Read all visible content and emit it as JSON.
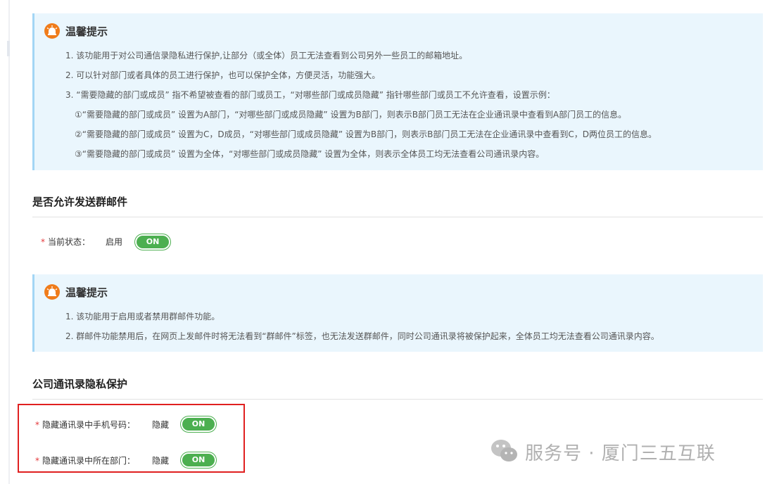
{
  "tip1": {
    "title": "温馨提示",
    "lines": [
      "1. 该功能用于对公司通信录隐私进行保护,让部分（或全体）员工无法查看到公司另外一些员工的邮箱地址。",
      "2. 可以针对部门或者具体的员工进行保护，也可以保护全体，方便灵活，功能强大。",
      "3. “需要隐藏的部门或成员” 指不希望被查看的部门或员工，“对哪些部门或成员隐藏” 指针哪些部门或员工不允许查看，设置示例：",
      "①“需要隐藏的部门或成员” 设置为A部门，“对哪些部门或成员隐藏” 设置为B部门，则表示B部门员工无法在企业通讯录中查看到A部门员工的信息。",
      "②“需要隐藏的部门或成员” 设置为C，D成员，“对哪些部门或成员隐藏” 设置为B部门，则表示B部门员工无法在企业通讯录中查看到C，D两位员工的信息。",
      "③“需要隐藏的部门或成员” 设置为全体，“对哪些部门或成员隐藏” 设置为全体，则表示全体员工均无法查看公司通讯录内容。"
    ]
  },
  "group_mail": {
    "title": "是否允许发送群邮件",
    "required_mark": "*",
    "status_label": "当前状态：",
    "status_value": "启用",
    "toggle": "ON"
  },
  "tip2": {
    "title": "温馨提示",
    "lines": [
      "1. 该功能用于启用或者禁用群邮件功能。",
      "2. 群邮件功能禁用后，在网页上发邮件时将无法看到“群邮件”标签，也无法发送群邮件，同时公司通讯录将被保护起来，全体员工均无法查看公司通讯录内容。"
    ]
  },
  "privacy": {
    "title": "公司通讯录隐私保护",
    "fields": [
      {
        "required_mark": "*",
        "label": "隐藏通讯录中手机号码：",
        "value": "隐藏",
        "toggle": "ON"
      },
      {
        "required_mark": "*",
        "label": "隐藏通讯录中所在部门：",
        "value": "隐藏",
        "toggle": "ON"
      }
    ]
  },
  "watermark": {
    "text": "服务号 · 厦门三五互联"
  },
  "colors": {
    "toggle_on": "#4caf50",
    "tip_bg": "#eaf6fd",
    "tip_border": "#a3d6f5",
    "required": "#e4393c",
    "highlight": "#e02020",
    "tip_icon": "#f07c1b"
  }
}
